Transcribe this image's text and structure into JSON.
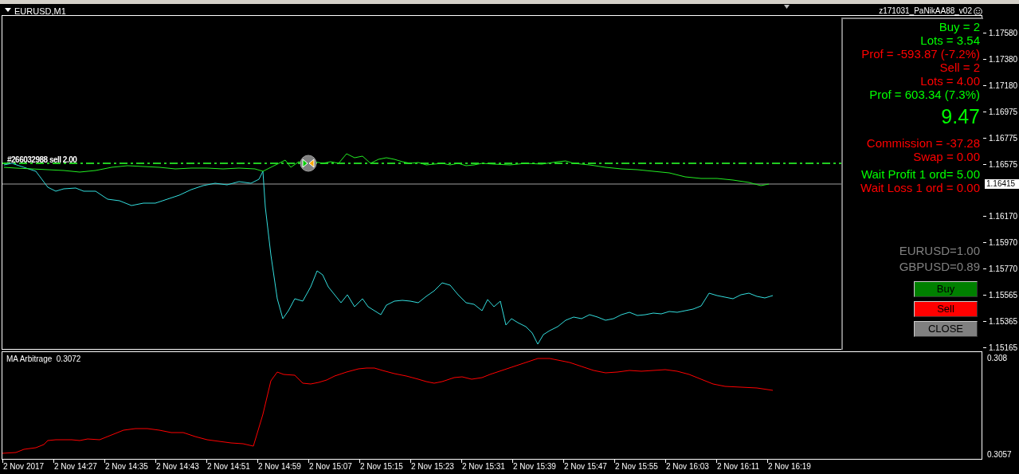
{
  "chart": {
    "symbol": "EURUSD,M1",
    "order_label": "#266032988 sell 2.00",
    "price_axis": [
      "1.17580",
      "1.17380",
      "1.17180",
      "1.16975",
      "1.16775",
      "1.16575",
      "1.16170",
      "1.15970",
      "1.15770",
      "1.15565",
      "1.15365",
      "1.15165"
    ],
    "current_price": "1.16415",
    "time_axis": [
      "2 Nov 2017",
      "2 Nov 14:27",
      "2 Nov 14:35",
      "2 Nov 14:43",
      "2 Nov 14:51",
      "2 Nov 14:59",
      "2 Nov 15:07",
      "2 Nov 15:15",
      "2 Nov 15:23",
      "2 Nov 15:31",
      "2 Nov 15:39",
      "2 Nov 15:47",
      "2 Nov 15:55",
      "2 Nov 16:03",
      "2 Nov 16:11",
      "2 Nov 16:19"
    ]
  },
  "indicator": {
    "title": "MA Arbitrage  0.3072",
    "axis": [
      "0.308",
      "0.3057"
    ]
  },
  "panel": {
    "title": "z171031_PaNikAA88_v02",
    "lines": [
      {
        "text": "Buy = 2",
        "color": "#00ff00",
        "kind": "normal"
      },
      {
        "text": "Lots = 3.54",
        "color": "#00ff00",
        "kind": "normal"
      },
      {
        "text": "Prof = -593.87 (-7.2%)",
        "color": "#ff0000",
        "kind": "normal"
      },
      {
        "text": "Sell = 2",
        "color": "#ff0000",
        "kind": "normal"
      },
      {
        "text": "Lots = 4.00",
        "color": "#ff0000",
        "kind": "normal"
      },
      {
        "text": "Prof = 603.34 (7.3%)",
        "color": "#00ff00",
        "kind": "normal"
      },
      {
        "text": "9.47",
        "color": "#00ff00",
        "kind": "big"
      },
      {
        "text": "Commission = -37.28",
        "color": "#ff0000",
        "kind": "normal"
      },
      {
        "text": "Swap = 0.00",
        "color": "#ff0000",
        "kind": "normal"
      },
      {
        "text": "Wait Profit 1 ord= 5.00",
        "color": "#00ff00",
        "kind": "normal"
      },
      {
        "text": "Wait Loss 1 ord = 0.00",
        "color": "#ff0000",
        "kind": "normal"
      }
    ],
    "ratios": [
      "EURUSD=1.00",
      "GBPUSD=0.89"
    ],
    "buttons": [
      {
        "label": "Buy",
        "color": "#008000"
      },
      {
        "label": "Sell",
        "color": "#ff0000"
      },
      {
        "label": "CLOSE",
        "color": "#808080"
      }
    ]
  }
}
